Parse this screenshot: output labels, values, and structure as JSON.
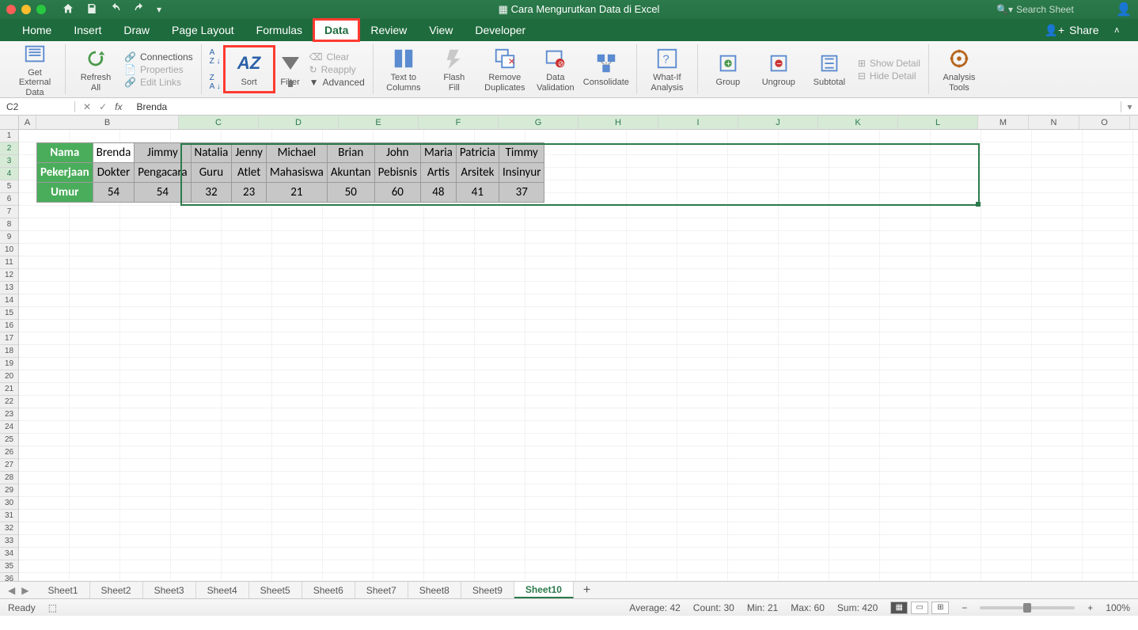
{
  "titlebar": {
    "doc_title": "Cara Mengurutkan Data di Excel",
    "search_placeholder": "Search Sheet"
  },
  "tabs": {
    "home": "Home",
    "insert": "Insert",
    "draw": "Draw",
    "pagelayout": "Page Layout",
    "formulas": "Formulas",
    "data": "Data",
    "review": "Review",
    "view": "View",
    "developer": "Developer",
    "share": "Share"
  },
  "ribbon": {
    "get_external": "Get External\nData",
    "refresh": "Refresh\nAll",
    "connections": "Connections",
    "properties": "Properties",
    "editlinks": "Edit Links",
    "sort": "Sort",
    "filter": "Filter",
    "clear": "Clear",
    "reapply": "Reapply",
    "advanced": "Advanced",
    "ttc": "Text to\nColumns",
    "flash": "Flash\nFill",
    "rdup": "Remove\nDuplicates",
    "dval": "Data\nValidation",
    "consol": "Consolidate",
    "whatif": "What-If\nAnalysis",
    "group": "Group",
    "ungroup": "Ungroup",
    "subtotal": "Subtotal",
    "showd": "Show Detail",
    "hided": "Hide Detail",
    "analysis": "Analysis\nTools"
  },
  "formula_bar": {
    "cell_ref": "C2",
    "fx": "fx",
    "value": "Brenda"
  },
  "column_letters": [
    "A",
    "B",
    "C",
    "D",
    "E",
    "F",
    "G",
    "H",
    "I",
    "J",
    "K",
    "L",
    "M",
    "N",
    "O"
  ],
  "row_headers_label": {
    "r2": "Nama",
    "r3": "Pekerjaan",
    "r4": "Umur"
  },
  "data_rows": {
    "names": [
      "Brenda",
      "Jimmy",
      "Natalia",
      "Jenny",
      "Michael",
      "Brian",
      "John",
      "Maria",
      "Patricia",
      "Timmy"
    ],
    "jobs": [
      "Dokter",
      "Pengacara",
      "Guru",
      "Atlet",
      "Mahasiswa",
      "Akuntan",
      "Pebisnis",
      "Artis",
      "Arsitek",
      "Insinyur"
    ],
    "ages": [
      "54",
      "54",
      "32",
      "23",
      "21",
      "50",
      "60",
      "48",
      "41",
      "37"
    ]
  },
  "sheets": [
    "Sheet1",
    "Sheet2",
    "Sheet3",
    "Sheet4",
    "Sheet5",
    "Sheet6",
    "Sheet7",
    "Sheet8",
    "Sheet9",
    "Sheet10"
  ],
  "active_sheet": "Sheet10",
  "status": {
    "ready": "Ready",
    "avg": "Average: 42",
    "count": "Count: 30",
    "min": "Min: 21",
    "max": "Max: 60",
    "sum": "Sum: 420",
    "zoom": "100%"
  }
}
